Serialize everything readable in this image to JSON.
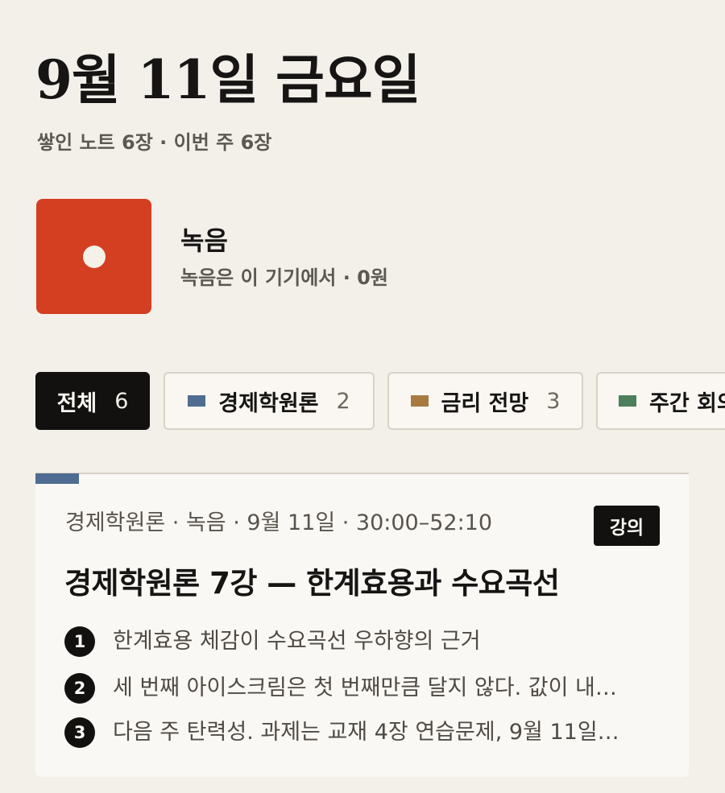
{
  "header": {
    "date_title": "9월 11일 금요일",
    "summary": "쌓인 노트 6장 · 이번 주 6장"
  },
  "recorder": {
    "icon": "record-dot-icon",
    "title": "녹음",
    "note": "녹음은 이 기기에서 · 0원",
    "color": "#d43f21"
  },
  "filters": {
    "all": {
      "label": "전체",
      "count": "6",
      "selected": true
    },
    "items": [
      {
        "label": "경제학원론",
        "count": "2",
        "color": "#4f6c92"
      },
      {
        "label": "금리 전망",
        "count": "3",
        "color": "#a87a40"
      },
      {
        "label": "주간 회의",
        "count": "",
        "color": "#4d7f5c"
      }
    ]
  },
  "note_card": {
    "meta": "경제학원론 · 녹음 · 9월 11일 · 30:00–52:10",
    "badge": "강의",
    "title": "경제학원론 7강 — 한계효용과 수요곡선",
    "accent_color": "#4f6c92",
    "points": [
      {
        "number": "1",
        "text": "한계효용 체감이 수요곡선 우하향의 근거"
      },
      {
        "number": "2",
        "text": "세 번째 아이스크림은 첫 번째만큼 달지 않다. 값이 내…"
      },
      {
        "number": "3",
        "text": "다음 주 탄력성. 과제는 교재 4장 연습문제, 9월 11일…"
      }
    ]
  }
}
